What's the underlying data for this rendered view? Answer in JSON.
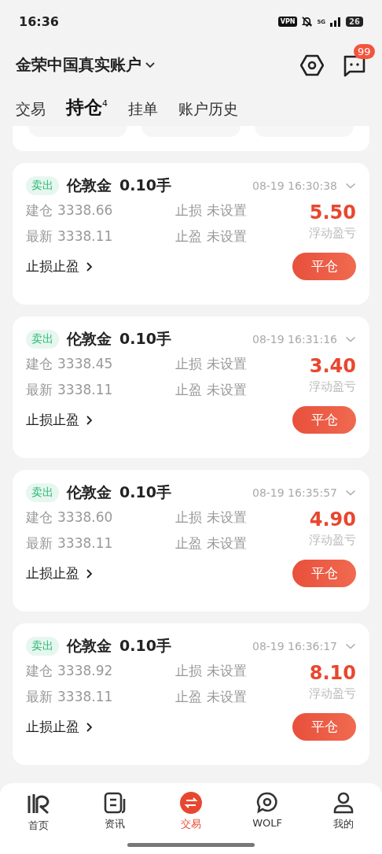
{
  "status_bar": {
    "time": "16:36",
    "vpn": "VPN",
    "network": "5G",
    "battery": "26"
  },
  "header": {
    "account": "金荣中国真实账户",
    "message_badge": "99"
  },
  "tabs": [
    {
      "label": "交易",
      "selected": false
    },
    {
      "label": "持仓",
      "selected": true,
      "badge": "4"
    },
    {
      "label": "挂单",
      "selected": false
    },
    {
      "label": "账户历史",
      "selected": false
    }
  ],
  "positions": [
    {
      "side": "卖出",
      "symbol": "伦敦金",
      "lots": "0.10手",
      "time": "08-19 16:30:38",
      "open_label": "建仓",
      "open_price": "3338.66",
      "latest_label": "最新",
      "latest_price": "3338.11",
      "sl_label": "止损",
      "sl_value": "未设置",
      "tp_label": "止盈",
      "tp_value": "未设置",
      "pnl": "5.50",
      "pnl_label": "浮动盈亏",
      "sltp_link": "止损止盈",
      "close_button": "平仓"
    },
    {
      "side": "卖出",
      "symbol": "伦敦金",
      "lots": "0.10手",
      "time": "08-19 16:31:16",
      "open_label": "建仓",
      "open_price": "3338.45",
      "latest_label": "最新",
      "latest_price": "3338.11",
      "sl_label": "止损",
      "sl_value": "未设置",
      "tp_label": "止盈",
      "tp_value": "未设置",
      "pnl": "3.40",
      "pnl_label": "浮动盈亏",
      "sltp_link": "止损止盈",
      "close_button": "平仓"
    },
    {
      "side": "卖出",
      "symbol": "伦敦金",
      "lots": "0.10手",
      "time": "08-19 16:35:57",
      "open_label": "建仓",
      "open_price": "3338.60",
      "latest_label": "最新",
      "latest_price": "3338.11",
      "sl_label": "止损",
      "sl_value": "未设置",
      "tp_label": "止盈",
      "tp_value": "未设置",
      "pnl": "4.90",
      "pnl_label": "浮动盈亏",
      "sltp_link": "止损止盈",
      "close_button": "平仓"
    },
    {
      "side": "卖出",
      "symbol": "伦敦金",
      "lots": "0.10手",
      "time": "08-19 16:36:17",
      "open_label": "建仓",
      "open_price": "3338.92",
      "latest_label": "最新",
      "latest_price": "3338.11",
      "sl_label": "止损",
      "sl_value": "未设置",
      "tp_label": "止盈",
      "tp_value": "未设置",
      "pnl": "8.10",
      "pnl_label": "浮动盈亏",
      "sltp_link": "止损止盈",
      "close_button": "平仓"
    }
  ],
  "bottom_nav": [
    {
      "kind": "home",
      "label": "首页",
      "selected": false
    },
    {
      "kind": "news",
      "label": "资讯",
      "selected": false
    },
    {
      "kind": "trade",
      "label": "交易",
      "selected": true
    },
    {
      "kind": "community",
      "label": "WOLF",
      "selected": false
    },
    {
      "kind": "profile",
      "label": "我的",
      "selected": false
    }
  ]
}
